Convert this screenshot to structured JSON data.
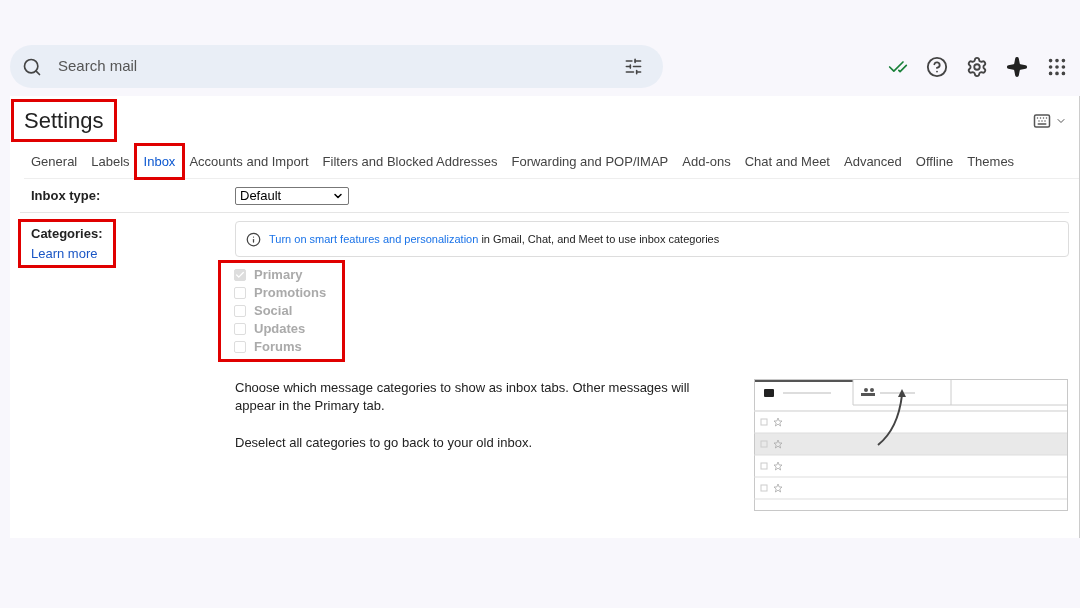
{
  "search": {
    "placeholder": "Search mail"
  },
  "settings": {
    "title": "Settings",
    "highlighted": true
  },
  "tabs": [
    {
      "label": "General",
      "selected": false,
      "highlighted": false
    },
    {
      "label": "Labels",
      "selected": false,
      "highlighted": false
    },
    {
      "label": "Inbox",
      "selected": true,
      "highlighted": true
    },
    {
      "label": "Accounts and Import",
      "selected": false,
      "highlighted": false
    },
    {
      "label": "Filters and Blocked Addresses",
      "selected": false,
      "highlighted": false
    },
    {
      "label": "Forwarding and POP/IMAP",
      "selected": false,
      "highlighted": false
    },
    {
      "label": "Add-ons",
      "selected": false,
      "highlighted": false
    },
    {
      "label": "Chat and Meet",
      "selected": false,
      "highlighted": false
    },
    {
      "label": "Advanced",
      "selected": false,
      "highlighted": false
    },
    {
      "label": "Offline",
      "selected": false,
      "highlighted": false
    },
    {
      "label": "Themes",
      "selected": false,
      "highlighted": false
    }
  ],
  "inbox_type": {
    "label": "Inbox type:",
    "value": "Default"
  },
  "categories": {
    "label": "Categories:",
    "link": "Learn more",
    "highlighted": true,
    "notice": {
      "link": "Turn on smart features and personalization",
      "text": "in Gmail, Chat, and Meet to use inbox categories"
    },
    "list_highlighted": true,
    "items": [
      {
        "label": "Primary",
        "checked": true,
        "disabled": true
      },
      {
        "label": "Promotions",
        "checked": false,
        "disabled": true
      },
      {
        "label": "Social",
        "checked": false,
        "disabled": true
      },
      {
        "label": "Updates",
        "checked": false,
        "disabled": true
      },
      {
        "label": "Forums",
        "checked": false,
        "disabled": true
      }
    ],
    "description": [
      "Choose which message categories to show as inbox tabs. Other messages will appear in the Primary tab.",
      "Deselect all categories to go back to your old inbox."
    ]
  }
}
